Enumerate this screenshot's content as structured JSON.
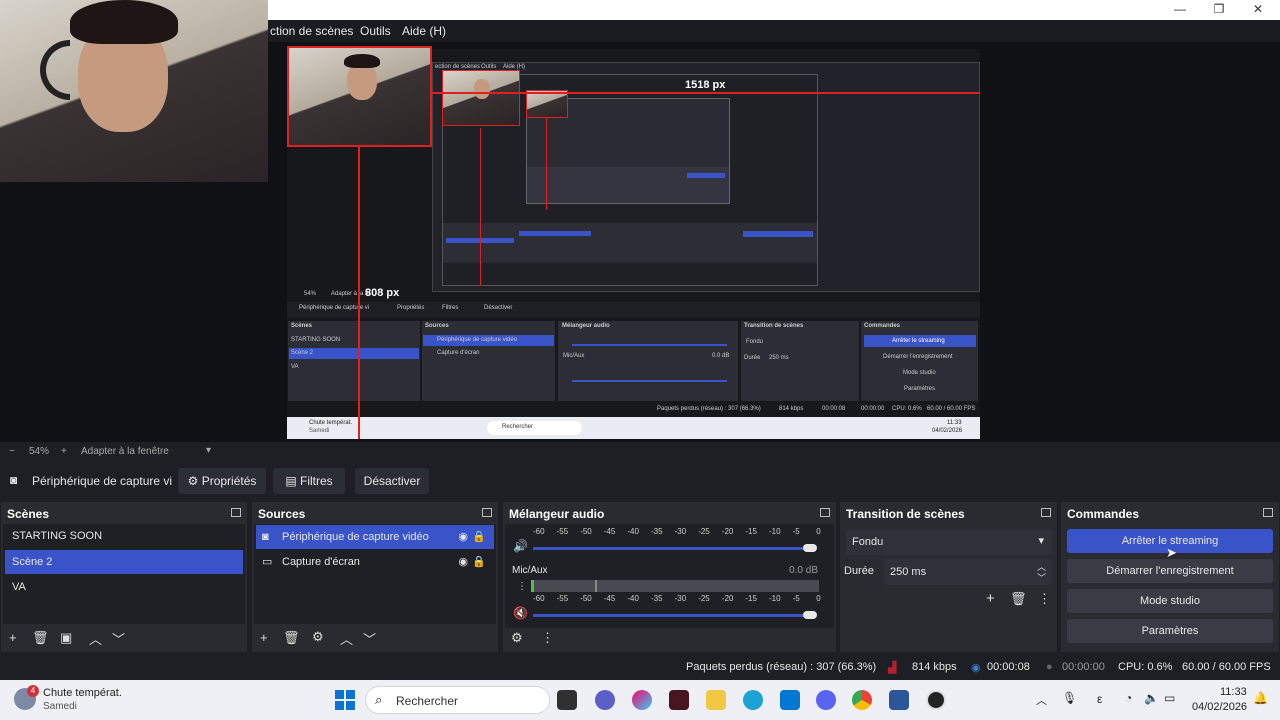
{
  "window": {
    "minimize": "—",
    "maximize": "❐",
    "close": "✕"
  },
  "menu": {
    "items": [
      "ction de scènes",
      "Outils",
      "Aide (H)"
    ]
  },
  "preview": {
    "px_width_label": "1518 px",
    "px_height_label": "808 px",
    "nested_menu": [
      "ection de scènes",
      "Outils",
      "Aide (H)"
    ],
    "nested_zoom": "54%",
    "nested_fit": "Adapter à la fe",
    "nested_source": "Périphérique de capture vi",
    "nested_props": "Propriétés",
    "nested_filters": "Filtres",
    "nested_disable": "Désactiver",
    "nested_docks": {
      "scenes": "Scènes",
      "sources": "Sources",
      "mixer": "Mélangeur audio",
      "transition": "Transition de scènes",
      "commands": "Commandes"
    },
    "nested_scenes": [
      "STARTING SOON",
      "Scène 2",
      "VA"
    ],
    "nested_sources": [
      "Périphérique de capture vidéo",
      "Capture d'écran"
    ],
    "nested_mic": "Mic/Aux",
    "nested_mic_db": "0.0 dB",
    "nested_fondu": "Fondu",
    "nested_duree": "Durée",
    "nested_duree_val": "250 ms",
    "nested_cmds": [
      "Arrêter le streaming",
      "Démarrer l'enregistrement",
      "Mode studio",
      "Paramètres"
    ],
    "nested_status": "Paquets perdus (réseau) : 307 (66.3%)",
    "nested_kbps": "814 kbps",
    "nested_time": "00:00:08",
    "nested_time2": "00:00:00",
    "nested_cpu": "CPU: 0.6%",
    "nested_fps": "60.00 / 60.00 FPS",
    "nested_weather": "Chute températ.",
    "nested_weather_day": "Samedi",
    "nested_search": "Rechercher",
    "nested_clock": "11:33",
    "nested_date": "04/02/2026"
  },
  "zoom": {
    "minus": "−",
    "value": "54%",
    "plus": "+",
    "fit": "Adapter à la fenêtre"
  },
  "source_toolbar": {
    "source_name": "Périphérique de capture vi",
    "properties": "Propriétés",
    "filters": "Filtres",
    "disable": "Désactiver"
  },
  "scenes": {
    "title": "Scènes",
    "items": [
      "STARTING SOON",
      "Scène 2",
      "VA"
    ],
    "selected": "Scène 2"
  },
  "sources": {
    "title": "Sources",
    "items": [
      "Périphérique de capture vidéo",
      "Capture d'écran"
    ]
  },
  "mixer": {
    "title": "Mélangeur audio",
    "scale": [
      "-60",
      "-55",
      "-50",
      "-45",
      "-40",
      "-35",
      "-30",
      "-25",
      "-20",
      "-15",
      "-10",
      "-5",
      "0"
    ],
    "channel_name": "Mic/Aux",
    "channel_db": "0.0 dB"
  },
  "transition": {
    "title": "Transition de scènes",
    "type": "Fondu",
    "duration_label": "Durée",
    "duration_value": "250 ms"
  },
  "commands": {
    "title": "Commandes",
    "stop_streaming": "Arrêter le streaming",
    "start_recording": "Démarrer l'enregistrement",
    "studio_mode": "Mode studio",
    "settings": "Paramètres"
  },
  "status": {
    "dropped": "Paquets perdus (réseau) : 307 (66.3%)",
    "bitrate": "814 kbps",
    "stream_time": "00:00:08",
    "rec_time": "00:00:00",
    "cpu": "CPU: 0.6%",
    "fps": "60.00 / 60.00 FPS"
  },
  "taskbar": {
    "weather_badge": "4",
    "weather_title": "Chute températ.",
    "weather_day": "Samedi",
    "search_placeholder": "Rechercher",
    "clock": "11:33",
    "date": "04/02/2026",
    "lang": "ε"
  },
  "colors": {
    "accent": "#3953c8",
    "panel": "#2a2b31",
    "background": "#1e1f24",
    "guide": "#e02020"
  }
}
